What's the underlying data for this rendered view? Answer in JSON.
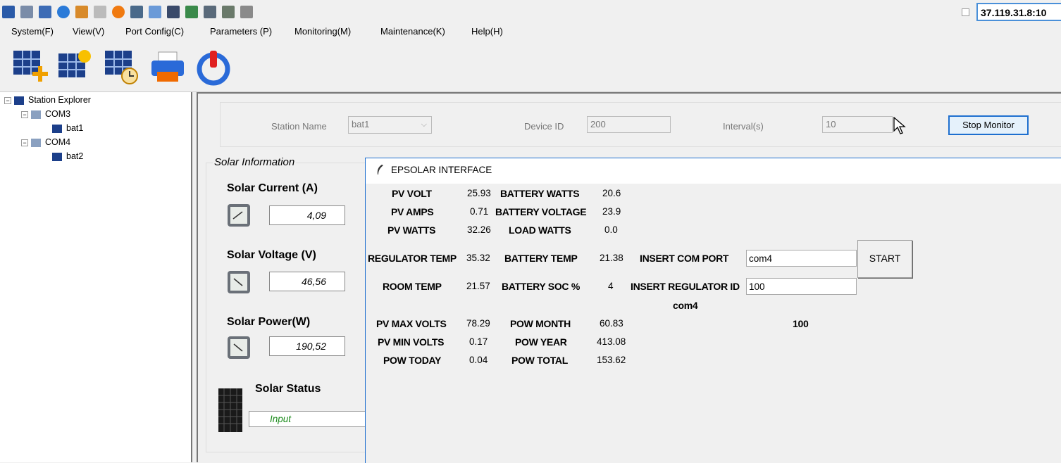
{
  "address": "37.119.31.8:10",
  "icons": [
    "monitor-icon",
    "windows-icon",
    "tools-icon",
    "refresh-icon",
    "paint-icon",
    "printer-icon",
    "alert-icon",
    "network-icon",
    "fullscreen-icon",
    "computer-icon",
    "export-icon",
    "text-icon",
    "screen-icon",
    "chat-icon"
  ],
  "menu": [
    "System(F)",
    "View(V)",
    "Port Config(C)",
    "Parameters (P)",
    "Monitoring(M)",
    "Maintenance(K)",
    "Help(H)"
  ],
  "tree": {
    "root": "Station Explorer",
    "ports": [
      {
        "name": "COM3",
        "station": "bat1"
      },
      {
        "name": "COM4",
        "station": "bat2"
      }
    ]
  },
  "station": {
    "name_label": "Station Name",
    "name_value": "bat1",
    "device_label": "Device ID",
    "device_value": "200",
    "interval_label": "Interval(s)",
    "interval_value": "10",
    "stop_label": "Stop Monitor"
  },
  "solar": {
    "group_title": "Solar Information",
    "current_label": "Solar Current (A)",
    "current_value": "4,09",
    "voltage_label": "Solar Voltage (V)",
    "voltage_value": "46,56",
    "power_label": "Solar Power(W)",
    "power_value": "190,52",
    "status_label": "Solar Status",
    "status_value": "Input"
  },
  "dialog": {
    "title": "EPSOLAR INTERFACE",
    "pv_volt_label": "PV VOLT",
    "pv_volt": "25.93",
    "pv_amps_label": "PV AMPS",
    "pv_amps": "0.71",
    "pv_watts_label": "PV WATTS",
    "pv_watts": "32.26",
    "bat_watts_label": "BATTERY WATTS",
    "bat_watts": "20.6",
    "bat_volt_label": "BATTERY VOLTAGE",
    "bat_volt": "23.9",
    "load_watts_label": "LOAD WATTS",
    "load_watts": "0.0",
    "reg_temp_label": "REGULATOR TEMP",
    "reg_temp": "35.32",
    "bat_temp_label": "BATTERY TEMP",
    "bat_temp": "21.38",
    "room_temp_label": "ROOM TEMP",
    "room_temp": "21.57",
    "bat_soc_label": "BATTERY SOC %",
    "bat_soc": "4",
    "com_port_label": "INSERT COM PORT",
    "com_port_value": "com4",
    "reg_id_label": "INSERT REGULATOR ID",
    "reg_id_value": "100",
    "start_label": "START",
    "com_echo": "com4",
    "id_echo": "100",
    "pv_max_label": "PV MAX VOLTS",
    "pv_max": "78.29",
    "pv_min_label": "PV MIN VOLTS",
    "pv_min": "0.17",
    "pow_today_label": "POW TODAY",
    "pow_today": "0.04",
    "pow_month_label": "POW MONTH",
    "pow_month": "60.83",
    "pow_year_label": "POW YEAR",
    "pow_year": "413.08",
    "pow_total_label": "POW TOTAL",
    "pow_total": "153.62"
  },
  "colors": {
    "accent": "#1e6fcf",
    "status_text": "#1a8a1a",
    "panel": "#f0f0f0"
  }
}
